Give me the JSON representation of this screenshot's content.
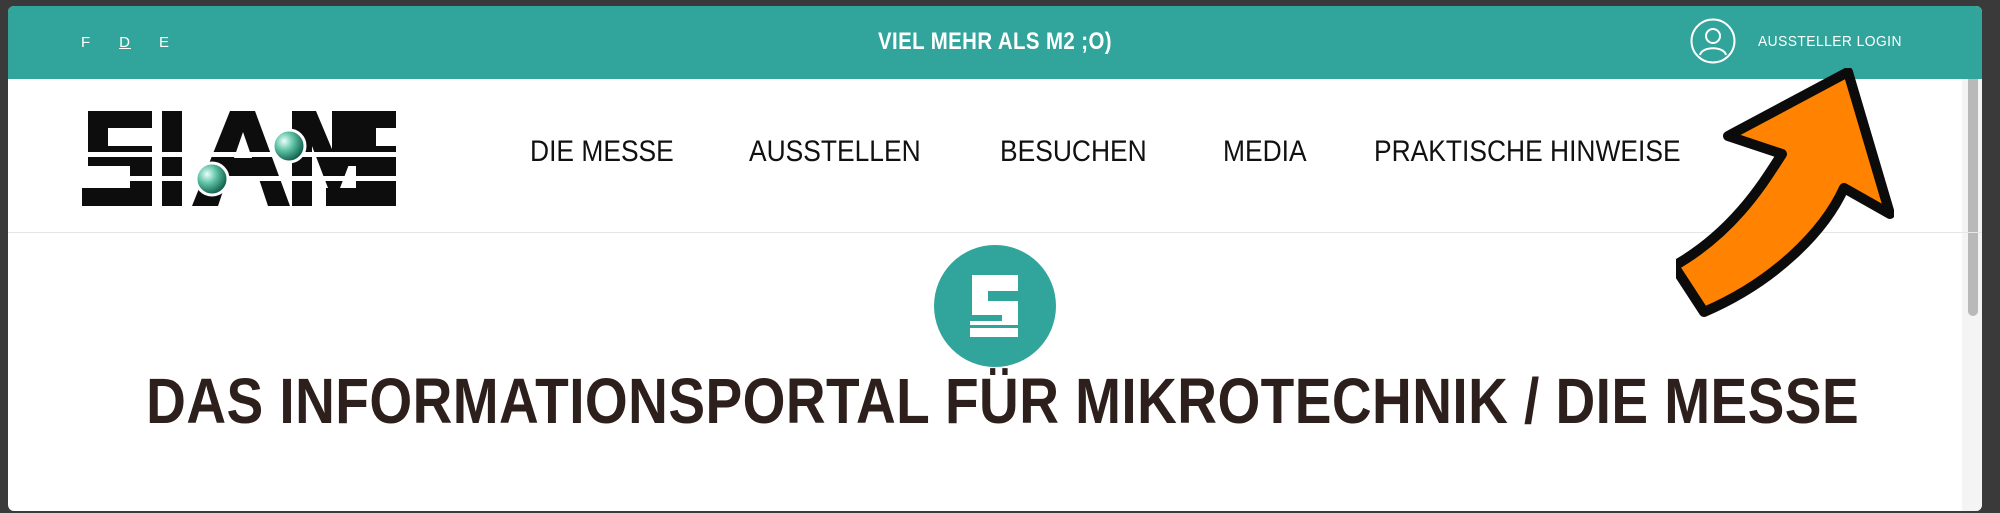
{
  "topbar": {
    "languages": [
      {
        "code": "F",
        "active": false
      },
      {
        "code": "D",
        "active": true
      },
      {
        "code": "E",
        "active": false
      }
    ],
    "tagline": "VIEL MEHR ALS M2 ;O)",
    "login_label": "AUSSTELLER LOGIN",
    "background": "#31a59b"
  },
  "logo": {
    "text": "SIAMS"
  },
  "nav": {
    "items": [
      "DIE MESSE",
      "AUSSTELLEN",
      "BESUCHEN",
      "MEDIA",
      "PRAKTISCHE HINWEISE"
    ]
  },
  "hero": {
    "badge_letter": "S",
    "headline": "DAS INFORMATIONSPORTAL FÜR MIKROTECHNIK / DIE MESSE"
  },
  "annotation": {
    "arrow_color": "#ff8200",
    "icon": "arrow-pointing-to-login"
  }
}
